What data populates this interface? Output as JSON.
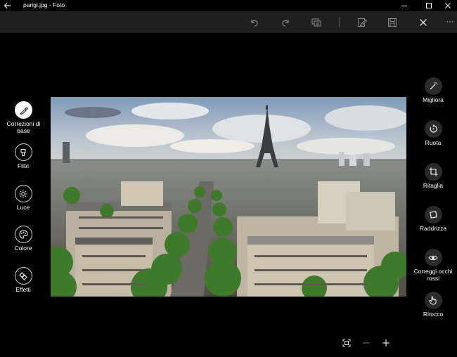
{
  "window": {
    "title": "parigi.jpg - Foto",
    "back_icon": "back-arrow-icon",
    "minimize_icon": "minimize-icon",
    "maximize_icon": "maximize-icon",
    "close_icon": "close-icon"
  },
  "toolbar": {
    "buttons": [
      "undo-icon",
      "redo-icon",
      "compare-icon",
      "edit-copy-icon",
      "save-icon",
      "close-icon",
      "more-icon"
    ],
    "more_label": "···"
  },
  "left_panel": {
    "items": [
      {
        "label": "Correzioni di base",
        "icon": "brush-icon",
        "active": true
      },
      {
        "label": "Filtri",
        "icon": "filter-icon",
        "active": false
      },
      {
        "label": "Luce",
        "icon": "sun-icon",
        "active": false
      },
      {
        "label": "Colore",
        "icon": "palette-icon",
        "active": false
      },
      {
        "label": "Effetti",
        "icon": "effects-icon",
        "active": false
      }
    ]
  },
  "right_panel": {
    "items": [
      {
        "label": "Migliora",
        "icon": "magic-wand-icon"
      },
      {
        "label": "Ruota",
        "icon": "rotate-icon"
      },
      {
        "label": "Ritaglia",
        "icon": "crop-icon"
      },
      {
        "label": "Raddrizza",
        "icon": "straighten-icon"
      },
      {
        "label": "Correggi occhi rossi",
        "line1": "Correggi occhi",
        "line2": "rossi",
        "icon": "eye-icon"
      },
      {
        "label": "Ritocco",
        "icon": "retouch-hand-icon"
      }
    ]
  },
  "zoom": {
    "fit_icon": "fit-to-window-icon",
    "zoom_out_icon": "zoom-out-icon",
    "zoom_in_icon": "zoom-in-icon"
  },
  "colors": {
    "background": "#000000",
    "toolbar": "#1f1f1f",
    "button_bg": "#2b2b2b"
  }
}
